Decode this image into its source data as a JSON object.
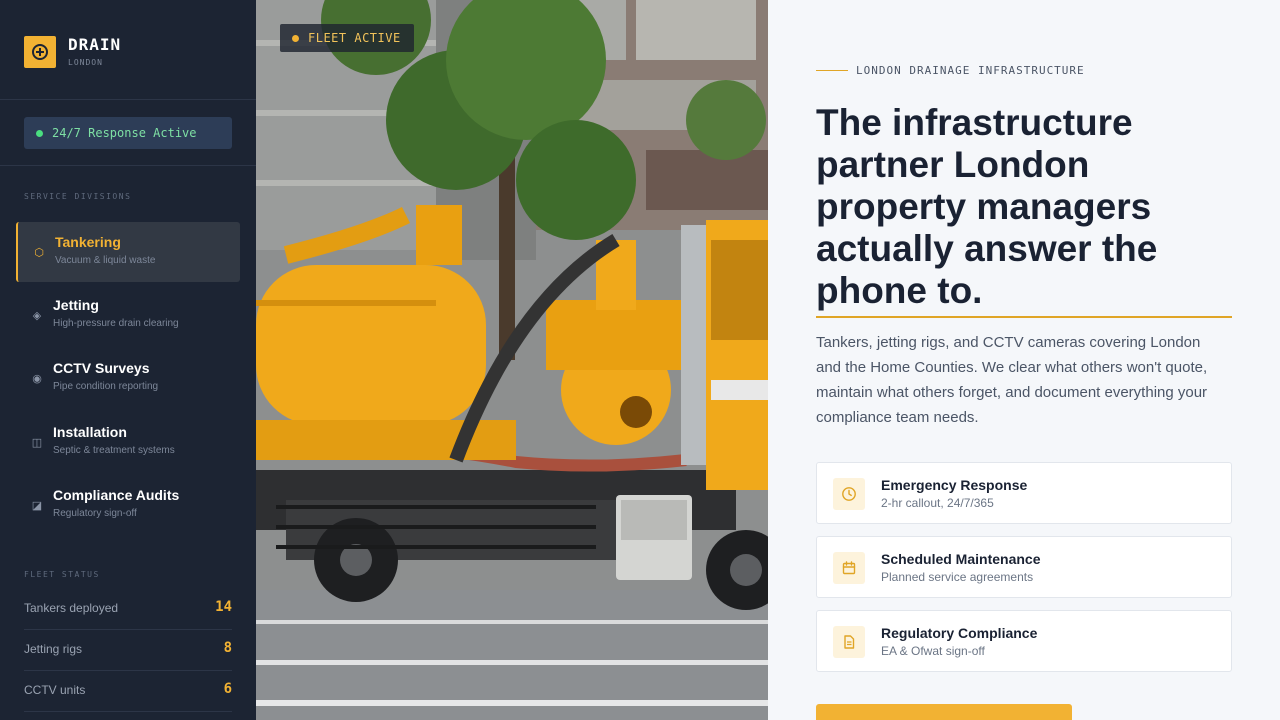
{
  "brand": {
    "name": "DRAIN",
    "subtitle": "LONDON"
  },
  "status_pill": {
    "text": "24/7 Response Active"
  },
  "sidebar": {
    "divisions_label": "SERVICE DIVISIONS",
    "items": [
      {
        "title": "Tankering",
        "desc": "Vacuum & liquid waste",
        "icon": "hexagon-icon",
        "active": true
      },
      {
        "title": "Jetting",
        "desc": "High-pressure drain clearing",
        "icon": "diamond-icon"
      },
      {
        "title": "CCTV Surveys",
        "desc": "Pipe condition reporting",
        "icon": "camera-lens-icon"
      },
      {
        "title": "Installation",
        "desc": "Septic & treatment systems",
        "icon": "tank-icon"
      },
      {
        "title": "Compliance Audits",
        "desc": "Regulatory sign-off",
        "icon": "clipboard-icon"
      }
    ],
    "fleet_label": "FLEET STATUS",
    "fleet": [
      {
        "label": "Tankers deployed",
        "value": "14"
      },
      {
        "label": "Jetting rigs",
        "value": "8"
      },
      {
        "label": "CCTV units",
        "value": "6"
      }
    ]
  },
  "photo": {
    "badge": "FLEET ACTIVE"
  },
  "hero": {
    "eyebrow": "LONDON DRAINAGE INFRASTRUCTURE",
    "headline": "The infrastructure partner London property managers actually answer the phone to.",
    "lede": "Tankers, jetting rigs, and CCTV cameras covering London and the Home Counties. We clear what others won't quote, maintain what others forget, and document everything your compliance team needs."
  },
  "features": [
    {
      "title": "Emergency Response",
      "desc": "2-hr callout, 24/7/365",
      "icon": "clock-icon"
    },
    {
      "title": "Scheduled Maintenance",
      "desc": "Planned service agreements",
      "icon": "calendar-icon"
    },
    {
      "title": "Regulatory Compliance",
      "desc": "EA & Ofwat sign-off",
      "icon": "document-icon"
    }
  ],
  "colors": {
    "accent": "#f2b233",
    "sidebar_bg": "#1c2433",
    "status_green": "#4ade80",
    "ink": "#1a2233"
  }
}
